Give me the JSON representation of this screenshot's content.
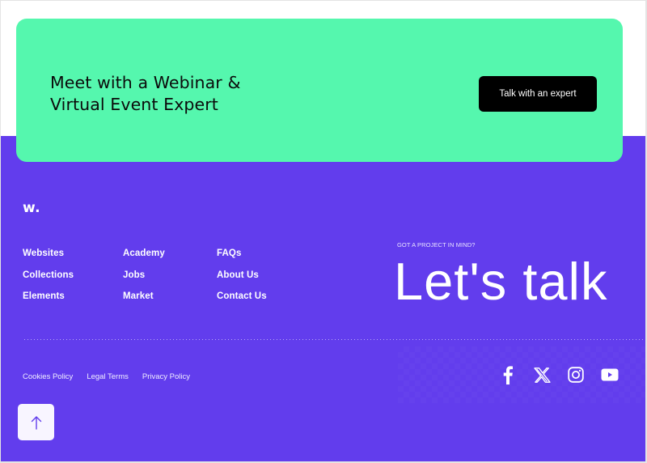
{
  "cta": {
    "title_line1": "Meet with a Webinar &",
    "title_line2": "Virtual Event Expert",
    "button_label": "Talk with an expert"
  },
  "footer": {
    "logo": "w.",
    "nav_columns": [
      {
        "links": [
          "Websites",
          "Collections",
          "Elements"
        ]
      },
      {
        "links": [
          "Academy",
          "Jobs",
          "Market"
        ]
      },
      {
        "links": [
          "FAQs",
          "About Us",
          "Contact Us"
        ]
      }
    ],
    "eyebrow": "GOT A PROJECT IN MIND?",
    "headline": "Let's talk",
    "legal_links": [
      "Cookies Policy",
      "Legal Terms",
      "Privacy Policy"
    ],
    "social": [
      {
        "icon": "facebook-icon",
        "label": "Facebook"
      },
      {
        "icon": "x-twitter-icon",
        "label": "X"
      },
      {
        "icon": "instagram-icon",
        "label": "Instagram"
      },
      {
        "icon": "youtube-icon",
        "label": "YouTube"
      }
    ],
    "scroll_top_icon": "arrow-up-icon"
  },
  "colors": {
    "cta_background": "#55f7ae",
    "footer_background": "#623ded",
    "button_background": "#000000",
    "text_light": "#ffffff"
  }
}
